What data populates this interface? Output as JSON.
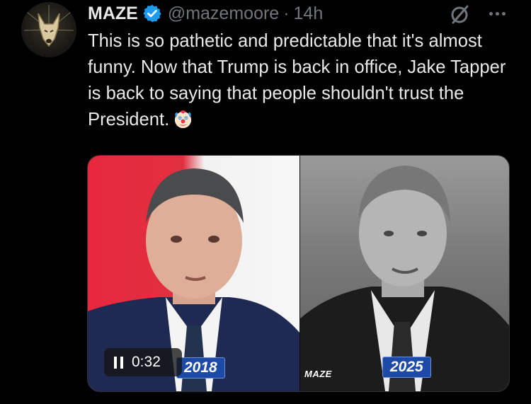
{
  "tweet": {
    "display_name": "MAZE",
    "handle": "@mazemoore",
    "separator": "·",
    "time": "14h",
    "text": "This is so pathetic and predictable that it's almost funny. Now that Trump is back in office, Jake Tapper is back to saying that people shouldn't trust the President.",
    "emoji": "clown-face"
  },
  "media": {
    "playback_time": "0:32",
    "left_year": "2018",
    "right_year": "2025",
    "watermark": "MAZE"
  },
  "colors": {
    "verified": "#1d9bf0",
    "secondary_text": "#71767b",
    "year_badge": "#1d4aa6"
  }
}
